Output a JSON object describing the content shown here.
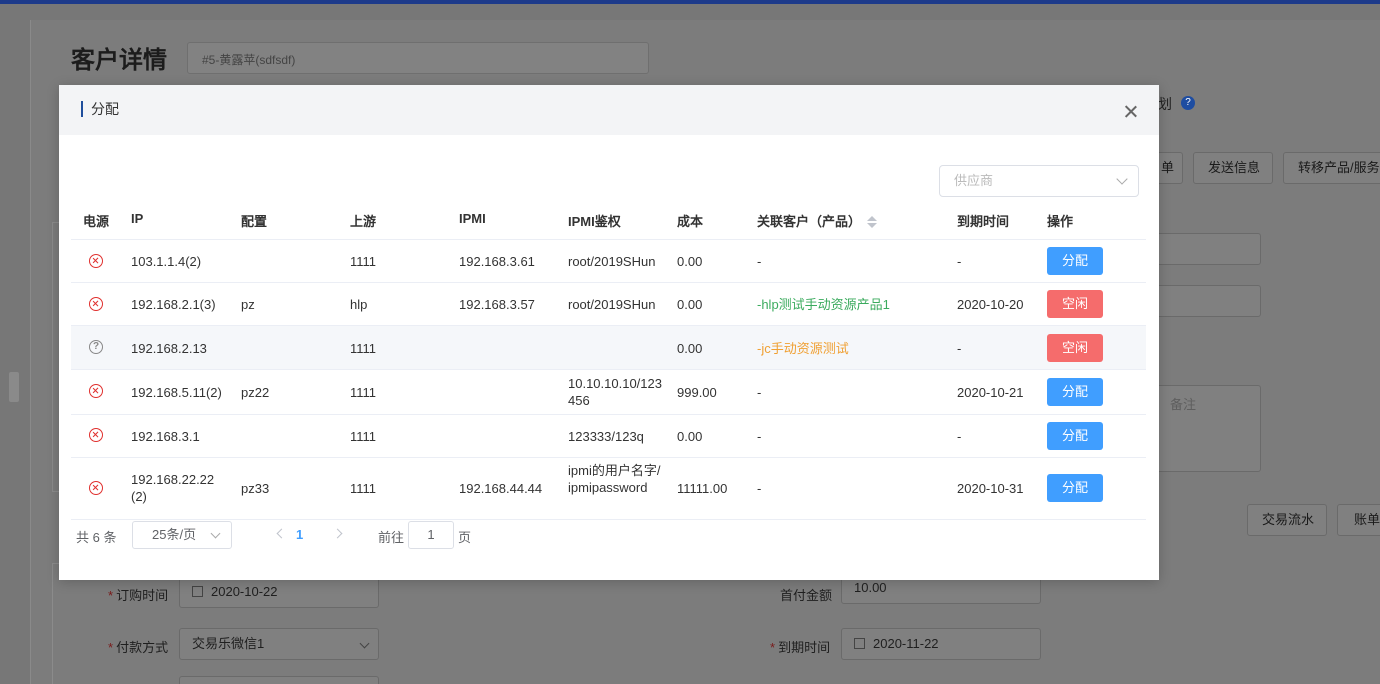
{
  "background": {
    "page_title": "客户详情",
    "title_input_value": "#5-黄露苹(sdfsdf)",
    "plan_label": "划",
    "help_icon": "?",
    "top_buttons": [
      "单",
      "发送信息",
      "转移产品/服务"
    ],
    "textarea_placeholder": "备注",
    "bottom_buttons": [
      "交易流水",
      "账单"
    ],
    "form": {
      "order_time_label": "订购时间",
      "order_time_value": "2020-10-22",
      "payment_method_label": "付款方式",
      "payment_method_value": "交易乐微信1",
      "first_payment_label": "首付金额",
      "first_payment_value": "10.00",
      "expire_time_label": "到期时间",
      "expire_time_value": "2020-11-22"
    }
  },
  "dialog": {
    "title": "分配",
    "supplier_placeholder": "供应商",
    "columns": {
      "power": "电源",
      "ip": "IP",
      "config": "配置",
      "upstream": "上游",
      "ipmi": "IPMI",
      "ipmi_auth": "IPMI鉴权",
      "cost": "成本",
      "customer": "关联客户（产品）",
      "expire": "到期时间",
      "action": "操作"
    },
    "rows": [
      {
        "power": "error",
        "ip": "103.1.1.4(2)",
        "config": "",
        "upstream": "1111",
        "ipmi": "192.168.3.61",
        "ipmi_auth": "root/2019SHun",
        "cost": "0.00",
        "customer": "-",
        "customer_color": "normal",
        "expire": "-",
        "action": "分配",
        "action_type": "assign"
      },
      {
        "power": "error",
        "ip": "192.168.2.1(3)",
        "config": "pz",
        "upstream": "hlp",
        "ipmi": "192.168.3.57",
        "ipmi_auth": "root/2019SHun",
        "cost": "0.00",
        "customer": "-hlp测试手动资源产品1",
        "customer_color": "green",
        "expire": "2020-10-20",
        "action": "空闲",
        "action_type": "free"
      },
      {
        "power": "unknown",
        "ip": "192.168.2.13",
        "config": "",
        "upstream": "1111",
        "ipmi": "",
        "ipmi_auth": "",
        "cost": "0.00",
        "customer": "-jc手动资源测试",
        "customer_color": "orange",
        "expire": "-",
        "action": "空闲",
        "action_type": "free"
      },
      {
        "power": "error",
        "ip": "192.168.5.11(2)",
        "config": "pz22",
        "upstream": "1111",
        "ipmi": "",
        "ipmi_auth": "10.10.10.10/123456",
        "cost": "999.00",
        "customer": "-",
        "customer_color": "normal",
        "expire": "2020-10-21",
        "action": "分配",
        "action_type": "assign"
      },
      {
        "power": "error",
        "ip": "192.168.3.1",
        "config": "",
        "upstream": "1111",
        "ipmi": "",
        "ipmi_auth": "123333/123q",
        "cost": "0.00",
        "customer": "-",
        "customer_color": "normal",
        "expire": "-",
        "action": "分配",
        "action_type": "assign"
      },
      {
        "power": "error",
        "ip": "192.168.22.22(2)",
        "config": "pz33",
        "upstream": "1111",
        "ipmi": "192.168.44.44",
        "ipmi_auth": "ipmi的用户名字/ipmipassword",
        "cost": "11111.00",
        "customer": "-",
        "customer_color": "normal",
        "expire": "2020-10-31",
        "action": "分配",
        "action_type": "assign"
      }
    ],
    "pagination": {
      "total": "共 6 条",
      "page_size": "25条/页",
      "current_page": "1",
      "goto_label": "前往",
      "goto_value": "1",
      "page_unit": "页"
    }
  },
  "colors": {
    "assign_button": "#409eff",
    "free_button": "#f56c6c",
    "customer_green": "#3bab5e",
    "customer_orange": "#f0a033",
    "status_error": "#e0302e"
  }
}
